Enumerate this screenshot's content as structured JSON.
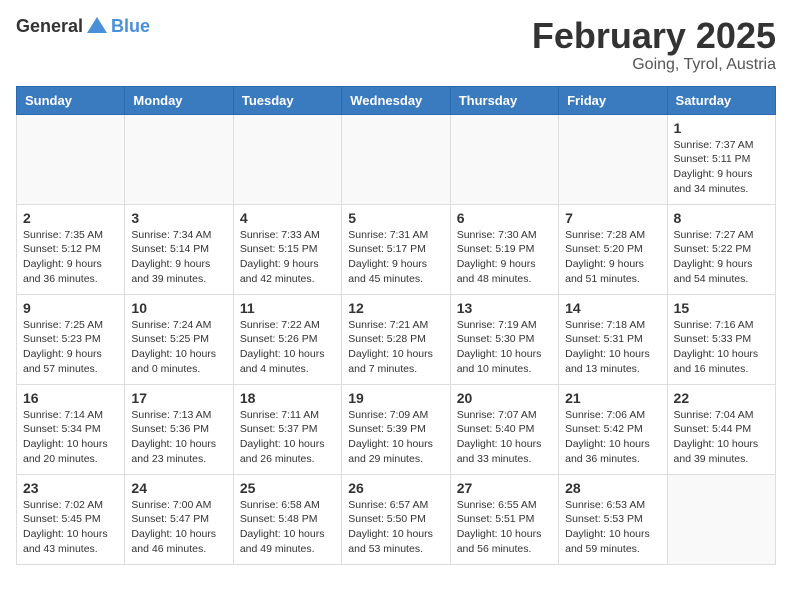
{
  "header": {
    "logo": {
      "general": "General",
      "blue": "Blue"
    },
    "title": "February 2025",
    "location": "Going, Tyrol, Austria"
  },
  "calendar": {
    "columns": [
      "Sunday",
      "Monday",
      "Tuesday",
      "Wednesday",
      "Thursday",
      "Friday",
      "Saturday"
    ],
    "weeks": [
      [
        {
          "day": "",
          "info": ""
        },
        {
          "day": "",
          "info": ""
        },
        {
          "day": "",
          "info": ""
        },
        {
          "day": "",
          "info": ""
        },
        {
          "day": "",
          "info": ""
        },
        {
          "day": "",
          "info": ""
        },
        {
          "day": "1",
          "info": "Sunrise: 7:37 AM\nSunset: 5:11 PM\nDaylight: 9 hours and 34 minutes."
        }
      ],
      [
        {
          "day": "2",
          "info": "Sunrise: 7:35 AM\nSunset: 5:12 PM\nDaylight: 9 hours and 36 minutes."
        },
        {
          "day": "3",
          "info": "Sunrise: 7:34 AM\nSunset: 5:14 PM\nDaylight: 9 hours and 39 minutes."
        },
        {
          "day": "4",
          "info": "Sunrise: 7:33 AM\nSunset: 5:15 PM\nDaylight: 9 hours and 42 minutes."
        },
        {
          "day": "5",
          "info": "Sunrise: 7:31 AM\nSunset: 5:17 PM\nDaylight: 9 hours and 45 minutes."
        },
        {
          "day": "6",
          "info": "Sunrise: 7:30 AM\nSunset: 5:19 PM\nDaylight: 9 hours and 48 minutes."
        },
        {
          "day": "7",
          "info": "Sunrise: 7:28 AM\nSunset: 5:20 PM\nDaylight: 9 hours and 51 minutes."
        },
        {
          "day": "8",
          "info": "Sunrise: 7:27 AM\nSunset: 5:22 PM\nDaylight: 9 hours and 54 minutes."
        }
      ],
      [
        {
          "day": "9",
          "info": "Sunrise: 7:25 AM\nSunset: 5:23 PM\nDaylight: 9 hours and 57 minutes."
        },
        {
          "day": "10",
          "info": "Sunrise: 7:24 AM\nSunset: 5:25 PM\nDaylight: 10 hours and 0 minutes."
        },
        {
          "day": "11",
          "info": "Sunrise: 7:22 AM\nSunset: 5:26 PM\nDaylight: 10 hours and 4 minutes."
        },
        {
          "day": "12",
          "info": "Sunrise: 7:21 AM\nSunset: 5:28 PM\nDaylight: 10 hours and 7 minutes."
        },
        {
          "day": "13",
          "info": "Sunrise: 7:19 AM\nSunset: 5:30 PM\nDaylight: 10 hours and 10 minutes."
        },
        {
          "day": "14",
          "info": "Sunrise: 7:18 AM\nSunset: 5:31 PM\nDaylight: 10 hours and 13 minutes."
        },
        {
          "day": "15",
          "info": "Sunrise: 7:16 AM\nSunset: 5:33 PM\nDaylight: 10 hours and 16 minutes."
        }
      ],
      [
        {
          "day": "16",
          "info": "Sunrise: 7:14 AM\nSunset: 5:34 PM\nDaylight: 10 hours and 20 minutes."
        },
        {
          "day": "17",
          "info": "Sunrise: 7:13 AM\nSunset: 5:36 PM\nDaylight: 10 hours and 23 minutes."
        },
        {
          "day": "18",
          "info": "Sunrise: 7:11 AM\nSunset: 5:37 PM\nDaylight: 10 hours and 26 minutes."
        },
        {
          "day": "19",
          "info": "Sunrise: 7:09 AM\nSunset: 5:39 PM\nDaylight: 10 hours and 29 minutes."
        },
        {
          "day": "20",
          "info": "Sunrise: 7:07 AM\nSunset: 5:40 PM\nDaylight: 10 hours and 33 minutes."
        },
        {
          "day": "21",
          "info": "Sunrise: 7:06 AM\nSunset: 5:42 PM\nDaylight: 10 hours and 36 minutes."
        },
        {
          "day": "22",
          "info": "Sunrise: 7:04 AM\nSunset: 5:44 PM\nDaylight: 10 hours and 39 minutes."
        }
      ],
      [
        {
          "day": "23",
          "info": "Sunrise: 7:02 AM\nSunset: 5:45 PM\nDaylight: 10 hours and 43 minutes."
        },
        {
          "day": "24",
          "info": "Sunrise: 7:00 AM\nSunset: 5:47 PM\nDaylight: 10 hours and 46 minutes."
        },
        {
          "day": "25",
          "info": "Sunrise: 6:58 AM\nSunset: 5:48 PM\nDaylight: 10 hours and 49 minutes."
        },
        {
          "day": "26",
          "info": "Sunrise: 6:57 AM\nSunset: 5:50 PM\nDaylight: 10 hours and 53 minutes."
        },
        {
          "day": "27",
          "info": "Sunrise: 6:55 AM\nSunset: 5:51 PM\nDaylight: 10 hours and 56 minutes."
        },
        {
          "day": "28",
          "info": "Sunrise: 6:53 AM\nSunset: 5:53 PM\nDaylight: 10 hours and 59 minutes."
        },
        {
          "day": "",
          "info": ""
        }
      ]
    ]
  }
}
